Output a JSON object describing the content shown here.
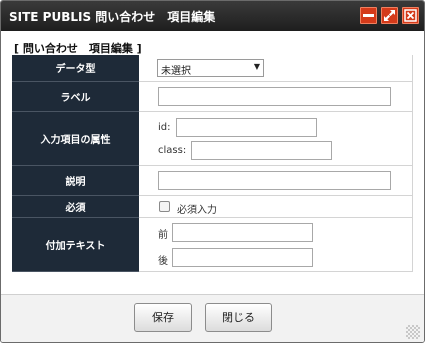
{
  "window": {
    "title": "SITE PUBLIS 問い合わせ　項目編集",
    "controls": {
      "minimize": "minimize-icon",
      "maximize": "expand-icon",
      "close": "close-icon"
    }
  },
  "section_title": "[ 問い合わせ　項目編集 ]",
  "form": {
    "data_type": {
      "label": "データ型",
      "selected": "未選択"
    },
    "label_field": {
      "label": "ラベル",
      "value": ""
    },
    "attributes": {
      "label": "入力項目の属性",
      "id_label": "id:",
      "id_value": "",
      "class_label": "class:",
      "class_value": ""
    },
    "description": {
      "label": "説明",
      "value": ""
    },
    "required": {
      "label": "必須",
      "checkbox_label": "必須入力",
      "checked": false
    },
    "additional_text": {
      "label": "付加テキスト",
      "before_label": "前",
      "before_value": "",
      "after_label": "後",
      "after_value": ""
    }
  },
  "buttons": {
    "save": "保存",
    "close": "閉じる"
  },
  "colors": {
    "titlebar": "#2a2a2a",
    "title_button": "#d43a1a",
    "header_cell": "#1e2a38"
  }
}
